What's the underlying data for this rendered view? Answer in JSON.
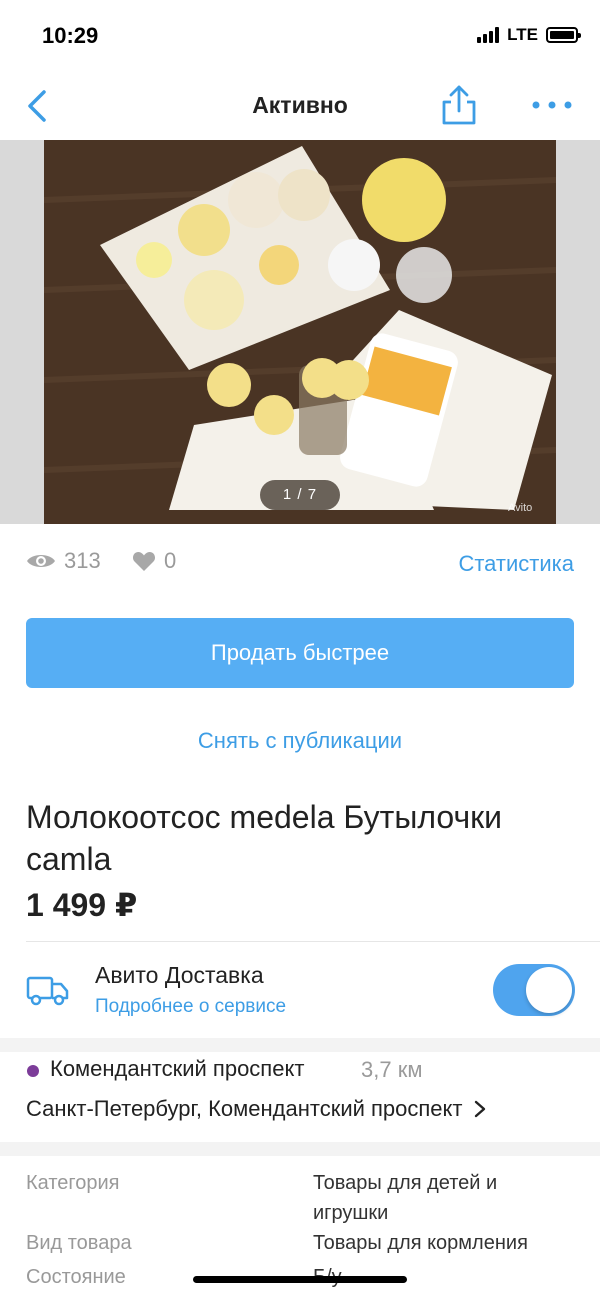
{
  "status_bar": {
    "time": "10:29",
    "network": "LTE"
  },
  "nav": {
    "title": "Активно",
    "icons": [
      "chevron-left-icon",
      "share-icon",
      "more-dots-icon"
    ]
  },
  "gallery": {
    "counter": "1 / 7",
    "watermark": "Avito"
  },
  "stats": {
    "views": "313",
    "favorites": "0",
    "statistics_link": "Статистика"
  },
  "actions": {
    "sell_faster": "Продать быстрее",
    "unpublish": "Снять с публикации"
  },
  "item": {
    "title": "Молокоотсос medela Бутылочки camla",
    "price": "1 499 ₽"
  },
  "delivery": {
    "title": "Авито Доставка",
    "link": "Подробнее о сервисе",
    "enabled": true
  },
  "location": {
    "metro": "Комендантский проспект",
    "metro_color": "#7c3c99",
    "distance": "3,7 км",
    "address": "Санкт-Петербург, Комендантский проспект"
  },
  "params": [
    {
      "label": "Категория",
      "value": "Товары для детей и игрушки"
    },
    {
      "label": "Вид товара",
      "value": "Товары для кормления"
    },
    {
      "label": "Состояние",
      "value": "Б/у"
    }
  ],
  "colors": {
    "accent": "#3d9de5",
    "button": "#56aef4",
    "toggle": "#4fa4ee"
  }
}
